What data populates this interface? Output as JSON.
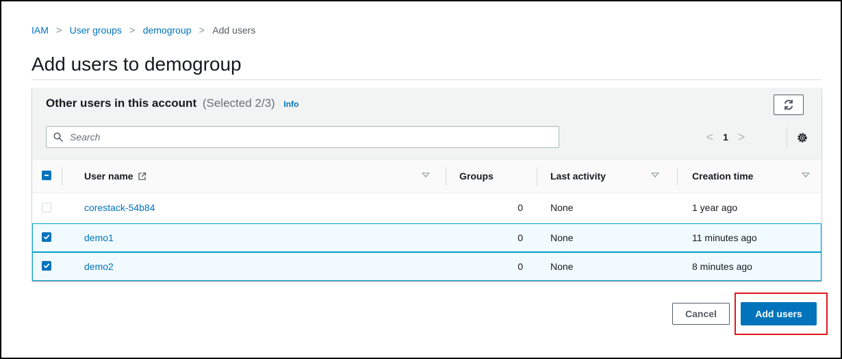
{
  "breadcrumb": {
    "items": [
      "IAM",
      "User groups",
      "demogroup"
    ],
    "current": "Add users",
    "separator": ">"
  },
  "page": {
    "title": "Add users to demogroup"
  },
  "panel": {
    "title": "Other users in this account",
    "counter": "(Selected 2/3)",
    "info_label": "Info",
    "refresh_icon": "refresh-icon",
    "search": {
      "placeholder": "Search",
      "value": ""
    },
    "pagination": {
      "prev": "<",
      "page": "1",
      "next": ">"
    },
    "settings_icon": "gear-icon"
  },
  "table": {
    "columns": [
      "User name",
      "Groups",
      "Last activity",
      "Creation time"
    ],
    "header_checkbox_state": "indeterminate",
    "rows": [
      {
        "user_name": "corestack-54b84",
        "groups": "0",
        "last_activity": "None",
        "creation_time": "1 year ago",
        "selected": false
      },
      {
        "user_name": "demo1",
        "groups": "0",
        "last_activity": "None",
        "creation_time": "11 minutes ago",
        "selected": true
      },
      {
        "user_name": "demo2",
        "groups": "0",
        "last_activity": "None",
        "creation_time": "8 minutes ago",
        "selected": true
      }
    ]
  },
  "actions": {
    "cancel_label": "Cancel",
    "add_label": "Add users"
  },
  "colors": {
    "link": "#0073bb",
    "primary": "#0073bb",
    "selected_row_bg": "#f1faff",
    "selected_row_border": "#00a1c9",
    "highlight": "#e0161b"
  }
}
